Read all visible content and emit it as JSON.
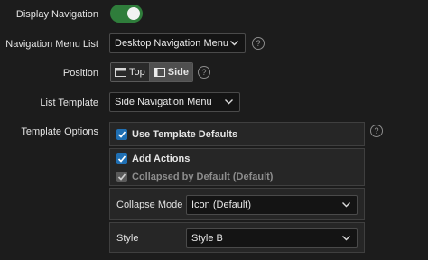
{
  "display_navigation": {
    "label": "Display Navigation",
    "enabled": true
  },
  "navigation_menu_list": {
    "label": "Navigation Menu List",
    "value": "Desktop Navigation Menu"
  },
  "position": {
    "label": "Position",
    "options": [
      "Top",
      "Side"
    ],
    "selected": "Side"
  },
  "list_template": {
    "label": "List Template",
    "value": "Side Navigation Menu"
  },
  "template_options": {
    "label": "Template Options",
    "use_template_defaults": {
      "label": "Use Template Defaults",
      "checked": true
    },
    "add_actions": {
      "label": "Add Actions",
      "checked": true
    },
    "collapsed_by_default": {
      "label": "Collapsed by Default (Default)",
      "checked": true,
      "disabled": true
    },
    "collapse_mode": {
      "label": "Collapse Mode",
      "value": "Icon (Default)"
    },
    "style": {
      "label": "Style",
      "value": "Style B"
    }
  },
  "help_glyph": "?",
  "colors": {
    "toggle_on": "#2f7d3b",
    "checkbox": "#1f6fb3",
    "background": "#1c1c1c"
  }
}
